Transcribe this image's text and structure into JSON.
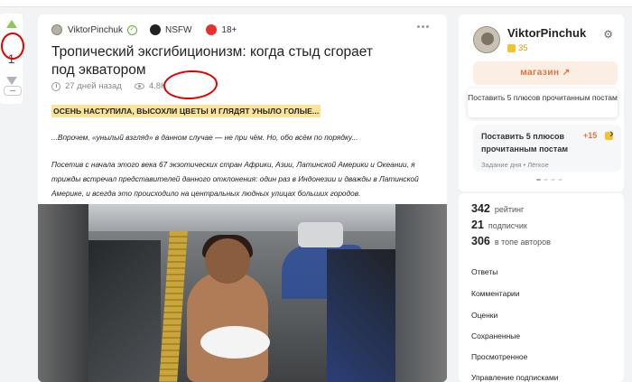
{
  "browser": {
    "url": ""
  },
  "vote": {
    "count": "1"
  },
  "post": {
    "author": "ViktorPinchuk",
    "community": "NSFW",
    "age_tag": "18+",
    "title": "Тропический эксгибиционизм: когда стыд сгорает под экватором",
    "time_ago": "27 дней назад",
    "views": "4.8K",
    "highlight": "ОСЕНЬ НАСТУПИЛА, ВЫСОХЛИ ЦВЕТЫ И ГЛЯДЯТ УНЫЛО ГОЛЫЕ...",
    "paragraph1": "...Впрочем, «унылый взгляд» в данном случае — не при чём. Но, обо всём по порядку...",
    "paragraph2": "Посетив с начала этого века 67 экзотических стран Африки, Азии, Латинской Америки и Океании, я трижды встречал представителей данного отклонения: один раз в Индонезии и дважды в Латинской Америке, и всегда это происходило на центральных людных улицах больших городов."
  },
  "profile": {
    "name": "ViktorPinchuk",
    "coins": "35",
    "shop_button": "магазин",
    "tooltip": "Поставить 5 плюсов прочитанным постам",
    "task": {
      "title": "Поставить 5 плюсов прочитанным постам",
      "reward": "+15",
      "meta": "Задание дня  •  Лёгкое"
    }
  },
  "stats": [
    {
      "value": "342",
      "label": "рейтинг"
    },
    {
      "value": "21",
      "label": "подписчик"
    },
    {
      "value": "306",
      "label": "в топе авторов"
    }
  ],
  "nav": [
    "Ответы",
    "Комментарии",
    "Оценки",
    "Сохраненные",
    "Просмотренное",
    "Управление подписками"
  ],
  "colors": {
    "accent": "#e0733b",
    "highlight": "#fbe39a",
    "annotation": "#e00000"
  }
}
